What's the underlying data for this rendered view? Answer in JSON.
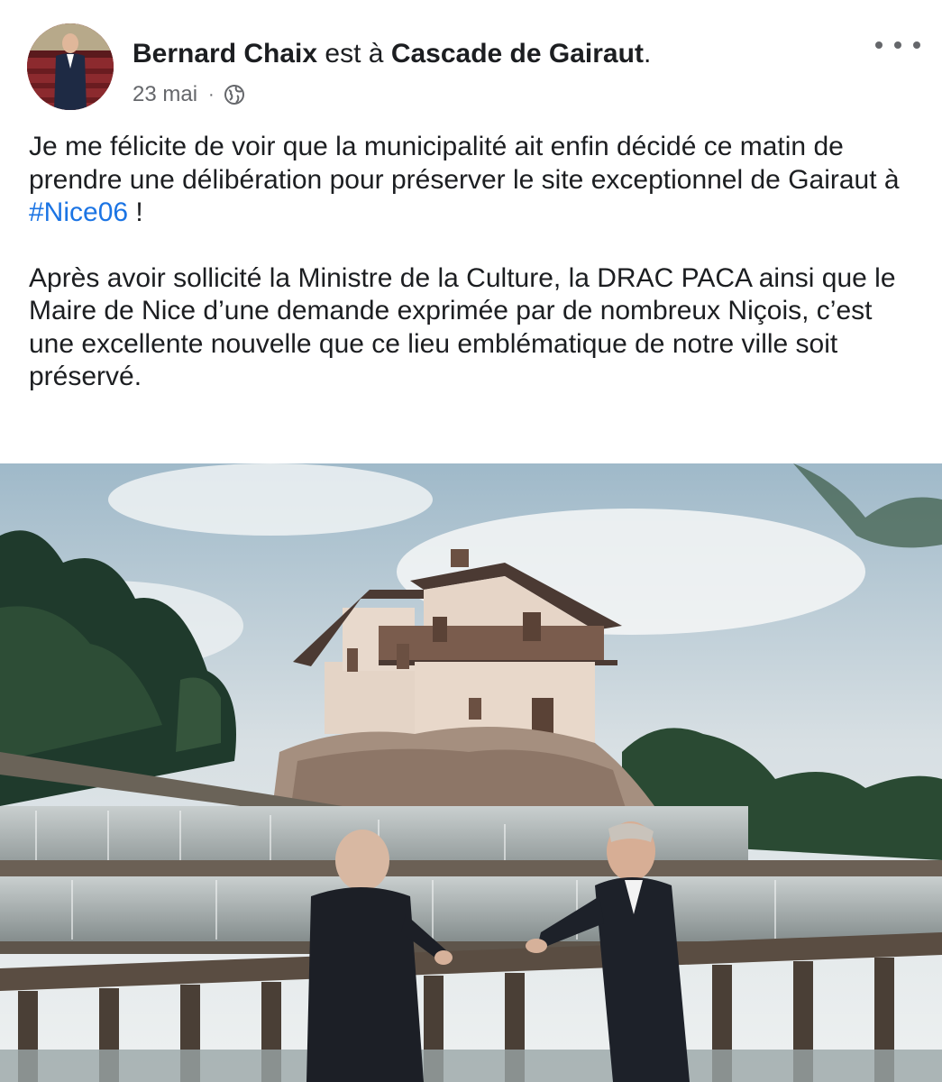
{
  "post": {
    "author": "Bernard Chaix",
    "connector": "est à",
    "place": "Cascade de Gairaut",
    "place_suffix": ".",
    "date": "23 mai",
    "separator": "·",
    "privacy_icon": "globe-icon",
    "more_icon": "more-dots-icon",
    "paragraph1_before": "Je me félicite de voir que la municipalité ait enfin décidé ce matin de prendre une délibération pour préserver le site exceptionnel de Gairaut à ",
    "hashtag": "#Nice06",
    "paragraph1_after": " !",
    "paragraph2": "Après avoir sollicité la Ministre de la Culture, la DRAC PACA ainsi que le Maire de Nice d’une demande exprimée par de nombreux Niçois, c’est une excellente nouvelle que ce lieu emblématique de notre ville soit préservé."
  },
  "colors": {
    "text": "#1c1e21",
    "secondary": "#65676b",
    "link": "#1b74e4"
  }
}
